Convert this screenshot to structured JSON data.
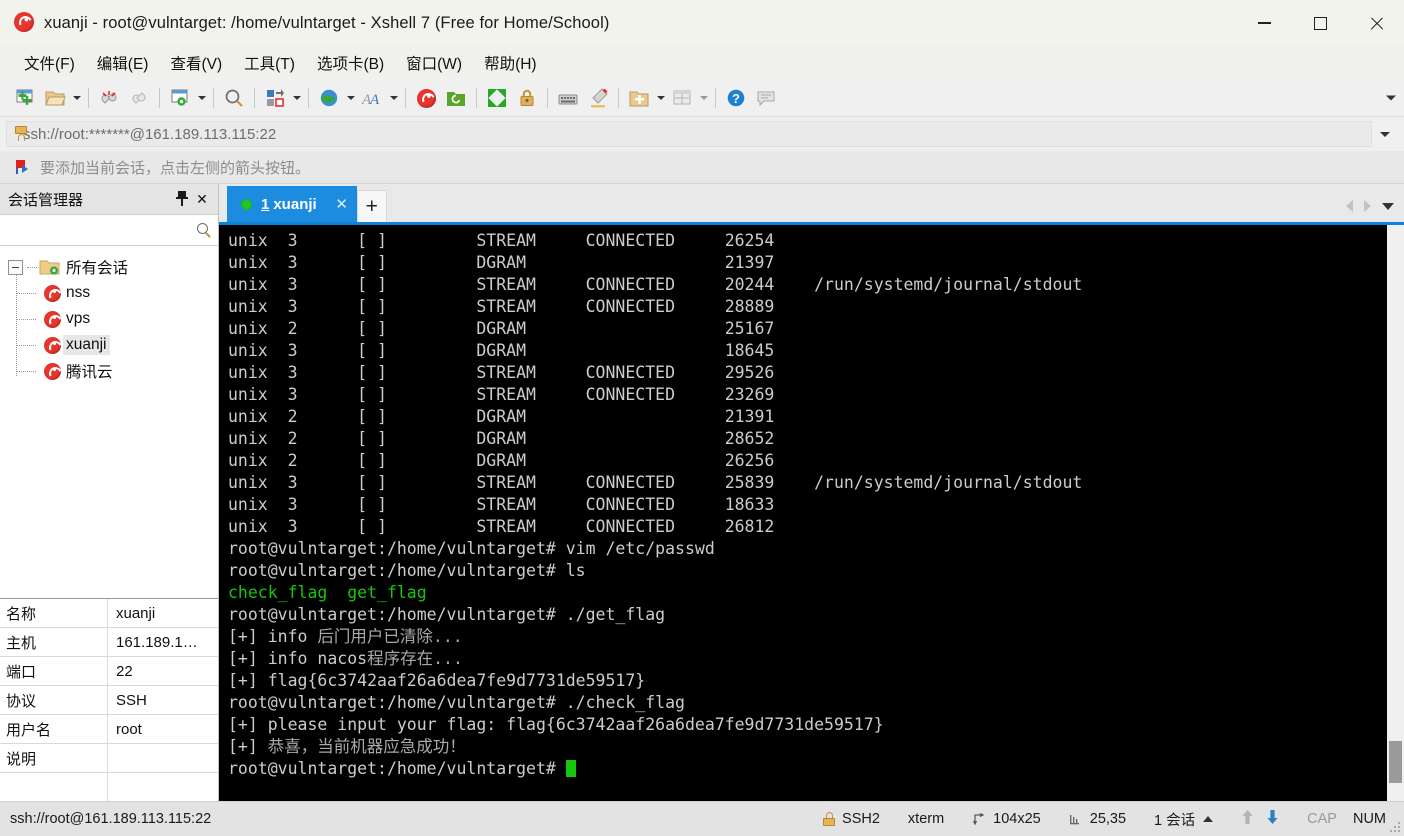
{
  "window": {
    "title": "xuanji - root@vulntarget: /home/vulntarget - Xshell 7 (Free for Home/School)",
    "app_icon": "xshell-logo-icon",
    "minimize": "—",
    "maximize": "□",
    "close": "✕"
  },
  "menubar": {
    "items": [
      {
        "label": "文件(F)",
        "name": "menu-file"
      },
      {
        "label": "编辑(E)",
        "name": "menu-edit"
      },
      {
        "label": "查看(V)",
        "name": "menu-view"
      },
      {
        "label": "工具(T)",
        "name": "menu-tools"
      },
      {
        "label": "选项卡(B)",
        "name": "menu-tabs"
      },
      {
        "label": "窗口(W)",
        "name": "menu-window"
      },
      {
        "label": "帮助(H)",
        "name": "menu-help"
      }
    ]
  },
  "toolbar": {
    "icons": [
      "new-session-icon",
      "open-folder-icon",
      "disconnect-icon",
      "reconnect-icon",
      "session-properties-icon",
      "find-icon",
      "file-transfer-icon",
      "globe-icon",
      "font-icon",
      "xshell-icon",
      "xftp-icon",
      "fullscreen-icon",
      "lock-icon",
      "keyboard-icon",
      "highlight-icon",
      "add-folder-icon",
      "layout-icon",
      "help-icon",
      "comment-icon"
    ],
    "overflow": "toolbar-overflow-chevron"
  },
  "address": {
    "lock_icon": "lock-icon",
    "url": "ssh://root:*******@161.189.113.115:22",
    "dropdown": "address-dropdown-chevron"
  },
  "notice": {
    "icon": "flag-icon",
    "text": "要添加当前会话，点击左侧的箭头按钮。"
  },
  "session_manager": {
    "title": "会话管理器",
    "pin_icon": "pin-icon",
    "close_icon": "close-icon",
    "search_placeholder": "",
    "search_icon": "search-icon",
    "tree": {
      "root_label": "所有会话",
      "root_icon": "folder-settings-icon",
      "children": [
        {
          "label": "nss",
          "icon": "xshell-session-icon",
          "selected": false
        },
        {
          "label": "vps",
          "icon": "xshell-session-icon",
          "selected": false
        },
        {
          "label": "xuanji",
          "icon": "xshell-session-icon",
          "selected": true
        },
        {
          "label": "腾讯云",
          "icon": "xshell-session-icon",
          "selected": false
        }
      ]
    },
    "properties": [
      {
        "key": "名称",
        "value": "xuanji"
      },
      {
        "key": "主机",
        "value": "161.189.1…"
      },
      {
        "key": "端口",
        "value": "22"
      },
      {
        "key": "协议",
        "value": "SSH"
      },
      {
        "key": "用户名",
        "value": "root"
      },
      {
        "key": "说明",
        "value": ""
      },
      {
        "key": "",
        "value": ""
      }
    ]
  },
  "tabs": {
    "items": [
      {
        "number": "1",
        "label": "xuanji",
        "status": "connected",
        "close": "✕"
      }
    ],
    "add_label": "+",
    "nav_left": "tab-scroll-left-icon",
    "nav_right": "tab-scroll-right-icon",
    "nav_down": "tab-list-chevron"
  },
  "terminal": {
    "lines": [
      {
        "segments": [
          {
            "text": "unix  3      [ ]         STREAM     CONNECTED     26254",
            "color": "white"
          }
        ]
      },
      {
        "segments": [
          {
            "text": "unix  3      [ ]         DGRAM                    21397",
            "color": "white"
          }
        ]
      },
      {
        "segments": [
          {
            "text": "unix  3      [ ]         STREAM     CONNECTED     20244    /run/systemd/journal/stdout",
            "color": "white"
          }
        ]
      },
      {
        "segments": [
          {
            "text": "unix  3      [ ]         STREAM     CONNECTED     28889",
            "color": "white"
          }
        ]
      },
      {
        "segments": [
          {
            "text": "unix  2      [ ]         DGRAM                    25167",
            "color": "white"
          }
        ]
      },
      {
        "segments": [
          {
            "text": "unix  3      [ ]         DGRAM                    18645",
            "color": "white"
          }
        ]
      },
      {
        "segments": [
          {
            "text": "unix  3      [ ]         STREAM     CONNECTED     29526",
            "color": "white"
          }
        ]
      },
      {
        "segments": [
          {
            "text": "unix  3      [ ]         STREAM     CONNECTED     23269",
            "color": "white"
          }
        ]
      },
      {
        "segments": [
          {
            "text": "unix  2      [ ]         DGRAM                    21391",
            "color": "white"
          }
        ]
      },
      {
        "segments": [
          {
            "text": "unix  2      [ ]         DGRAM                    28652",
            "color": "white"
          }
        ]
      },
      {
        "segments": [
          {
            "text": "unix  2      [ ]         DGRAM                    26256",
            "color": "white"
          }
        ]
      },
      {
        "segments": [
          {
            "text": "unix  3      [ ]         STREAM     CONNECTED     25839    /run/systemd/journal/stdout",
            "color": "white"
          }
        ]
      },
      {
        "segments": [
          {
            "text": "unix  3      [ ]         STREAM     CONNECTED     18633",
            "color": "white"
          }
        ]
      },
      {
        "segments": [
          {
            "text": "unix  3      [ ]         STREAM     CONNECTED     26812",
            "color": "white"
          }
        ]
      },
      {
        "segments": [
          {
            "text": "root@vulntarget:/home/vulntarget# vim /etc/passwd",
            "color": "white"
          }
        ]
      },
      {
        "segments": [
          {
            "text": "root@vulntarget:/home/vulntarget# ls",
            "color": "white"
          }
        ]
      },
      {
        "segments": [
          {
            "text": "check_flag  get_flag",
            "color": "green"
          }
        ]
      },
      {
        "segments": [
          {
            "text": "root@vulntarget:/home/vulntarget# ./get_flag",
            "color": "white"
          }
        ]
      },
      {
        "segments": [
          {
            "text": "[+] info ",
            "color": "white"
          },
          {
            "text": "后门用户已清除...",
            "color": "grey"
          }
        ]
      },
      {
        "segments": [
          {
            "text": "[+] info nacos",
            "color": "white"
          },
          {
            "text": "程序存在...",
            "color": "grey"
          }
        ]
      },
      {
        "segments": [
          {
            "text": "[+] flag{6c3742aaf26a6dea7fe9d7731de59517}",
            "color": "white"
          }
        ]
      },
      {
        "segments": [
          {
            "text": "root@vulntarget:/home/vulntarget# ./check_flag",
            "color": "white"
          }
        ]
      },
      {
        "segments": [
          {
            "text": "[+] please input your flag: flag{6c3742aaf26a6dea7fe9d7731de59517}",
            "color": "white"
          }
        ]
      },
      {
        "segments": [
          {
            "text": "[+] ",
            "color": "white"
          },
          {
            "text": "恭喜，当前机器应急成功！",
            "color": "grey"
          }
        ]
      },
      {
        "segments": [
          {
            "text": "root@vulntarget:/home/vulntarget# ",
            "color": "white"
          },
          {
            "text": "",
            "cursor": true
          }
        ]
      }
    ],
    "colors": {
      "background": "#000000",
      "foreground": "#cccccc",
      "green": "#16c60c",
      "grey": "#a9a9a9",
      "cursor": "#16c60c"
    }
  },
  "statusbar": {
    "connection": "ssh://root@161.189.113.115:22",
    "cells": [
      {
        "icon": "lock-icon",
        "label": "SSH2",
        "name": "status-protocol"
      },
      {
        "icon": "",
        "label": "xterm",
        "name": "status-terminal-type"
      },
      {
        "icon": "resize-icon",
        "label": "104x25",
        "name": "status-size"
      },
      {
        "icon": "cursor-pos-icon",
        "label": "25,35",
        "name": "status-cursor-position"
      },
      {
        "icon": "",
        "label": "1 会话",
        "name": "status-session-count"
      }
    ],
    "upload_icon": "arrow-up-icon",
    "download_icon": "arrow-down-icon",
    "caps": "CAP",
    "num": "NUM"
  }
}
